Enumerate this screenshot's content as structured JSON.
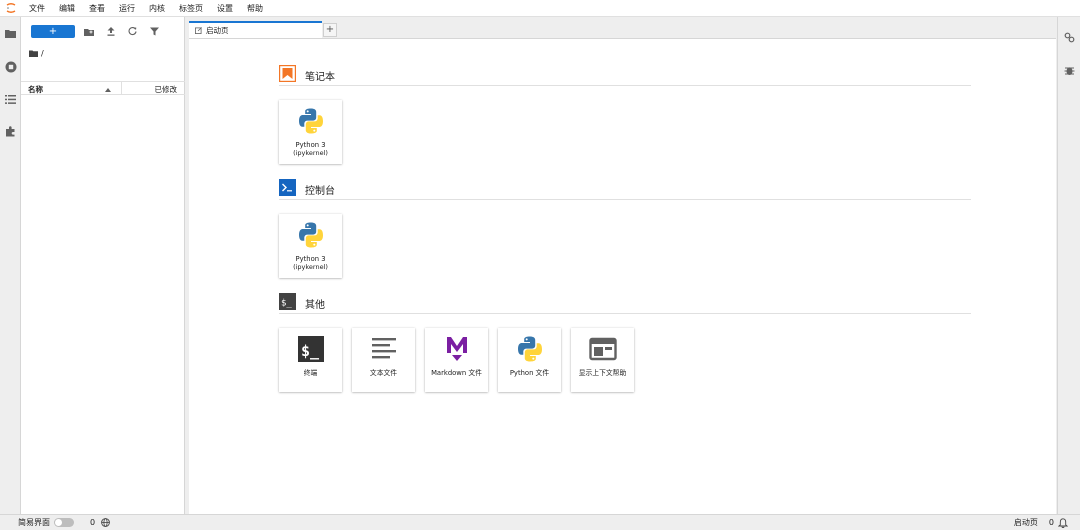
{
  "menubar": {
    "items": [
      "文件",
      "编辑",
      "查看",
      "运行",
      "内核",
      "标签页",
      "设置",
      "帮助"
    ]
  },
  "left_rail": {
    "icons": [
      "folder-icon",
      "running-icon",
      "toc-icon",
      "extension-icon"
    ]
  },
  "file_browser": {
    "new_label": "+",
    "breadcrumb": "/",
    "columns": {
      "name": "名称",
      "modified": "已修改"
    }
  },
  "tabs": [
    {
      "label": "启动页",
      "active": true
    }
  ],
  "tab_add_label": "+",
  "launcher": {
    "sections": [
      {
        "title": "笔记本",
        "icon": "notebook-icon",
        "cards": [
          {
            "label": "Python 3",
            "sublabel": "(ipykernel)",
            "icon": "python-icon"
          }
        ]
      },
      {
        "title": "控制台",
        "icon": "console-icon",
        "cards": [
          {
            "label": "Python 3",
            "sublabel": "(ipykernel)",
            "icon": "python-icon"
          }
        ]
      },
      {
        "title": "其他",
        "icon": "other-icon",
        "cards": [
          {
            "label": "终端",
            "icon": "terminal-icon"
          },
          {
            "label": "文本文件",
            "icon": "text-file-icon"
          },
          {
            "label": "Markdown 文件",
            "icon": "markdown-icon"
          },
          {
            "label": "Python 文件",
            "icon": "python-icon"
          },
          {
            "label": "显示上下文帮助",
            "icon": "context-help-icon"
          }
        ]
      }
    ]
  },
  "statusbar": {
    "simple_mode_label": "简易界面",
    "kernel_count": "0",
    "terminal_count": "0",
    "current_tab": "启动页",
    "notification_count": "0"
  },
  "colors": {
    "accent": "#1976d2",
    "notebook_orange": "#f37626",
    "console_blue": "#0d47a1",
    "markdown_purple": "#7b1fa2"
  }
}
